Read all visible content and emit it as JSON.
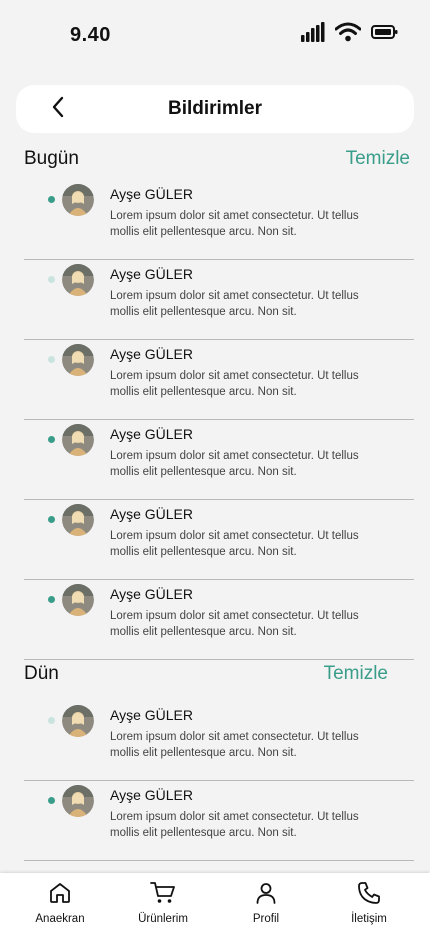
{
  "status": {
    "time": "9.40"
  },
  "header": {
    "title": "Bildirimler",
    "back_icon": "chevron-left-icon"
  },
  "colors": {
    "accent": "#3a9d8a",
    "unread_dot": "#3a9d8a",
    "read_dot": "#c9e3de"
  },
  "sections": [
    {
      "title": "Bugün",
      "clear_label": "Temizle",
      "items": [
        {
          "name": "Ayşe GÜLER",
          "text": "Lorem ipsum dolor sit amet consectetur. Ut tellus mollis elit pellentesque arcu. Non sit.",
          "unread": true
        },
        {
          "name": "Ayşe GÜLER",
          "text": "Lorem ipsum dolor sit amet consectetur. Ut tellus mollis elit pellentesque arcu. Non sit.",
          "unread": false
        },
        {
          "name": "Ayşe GÜLER",
          "text": "Lorem ipsum dolor sit amet consectetur. Ut tellus mollis elit pellentesque arcu. Non sit.",
          "unread": false
        },
        {
          "name": "Ayşe GÜLER",
          "text": "Lorem ipsum dolor sit amet consectetur. Ut tellus mollis elit pellentesque arcu. Non sit.",
          "unread": true
        },
        {
          "name": "Ayşe GÜLER",
          "text": "Lorem ipsum dolor sit amet consectetur. Ut tellus mollis elit pellentesque arcu. Non sit.",
          "unread": true
        },
        {
          "name": "Ayşe GÜLER",
          "text": "Lorem ipsum dolor sit amet consectetur. Ut tellus mollis elit pellentesque arcu. Non sit.",
          "unread": true
        }
      ]
    },
    {
      "title": "Dün",
      "clear_label": "Temizle",
      "items": [
        {
          "name": "Ayşe GÜLER",
          "text": "Lorem ipsum dolor sit amet consectetur. Ut tellus mollis elit pellentesque arcu. Non sit.",
          "unread": false
        },
        {
          "name": "Ayşe GÜLER",
          "text": "Lorem ipsum dolor sit amet consectetur. Ut tellus mollis elit pellentesque arcu. Non sit.",
          "unread": true
        }
      ]
    }
  ],
  "tabs": [
    {
      "label": "Anaekran",
      "icon": "home-icon"
    },
    {
      "label": "Ürünlerim",
      "icon": "cart-icon"
    },
    {
      "label": "Profil",
      "icon": "user-icon"
    },
    {
      "label": "İletişim",
      "icon": "phone-icon"
    }
  ]
}
